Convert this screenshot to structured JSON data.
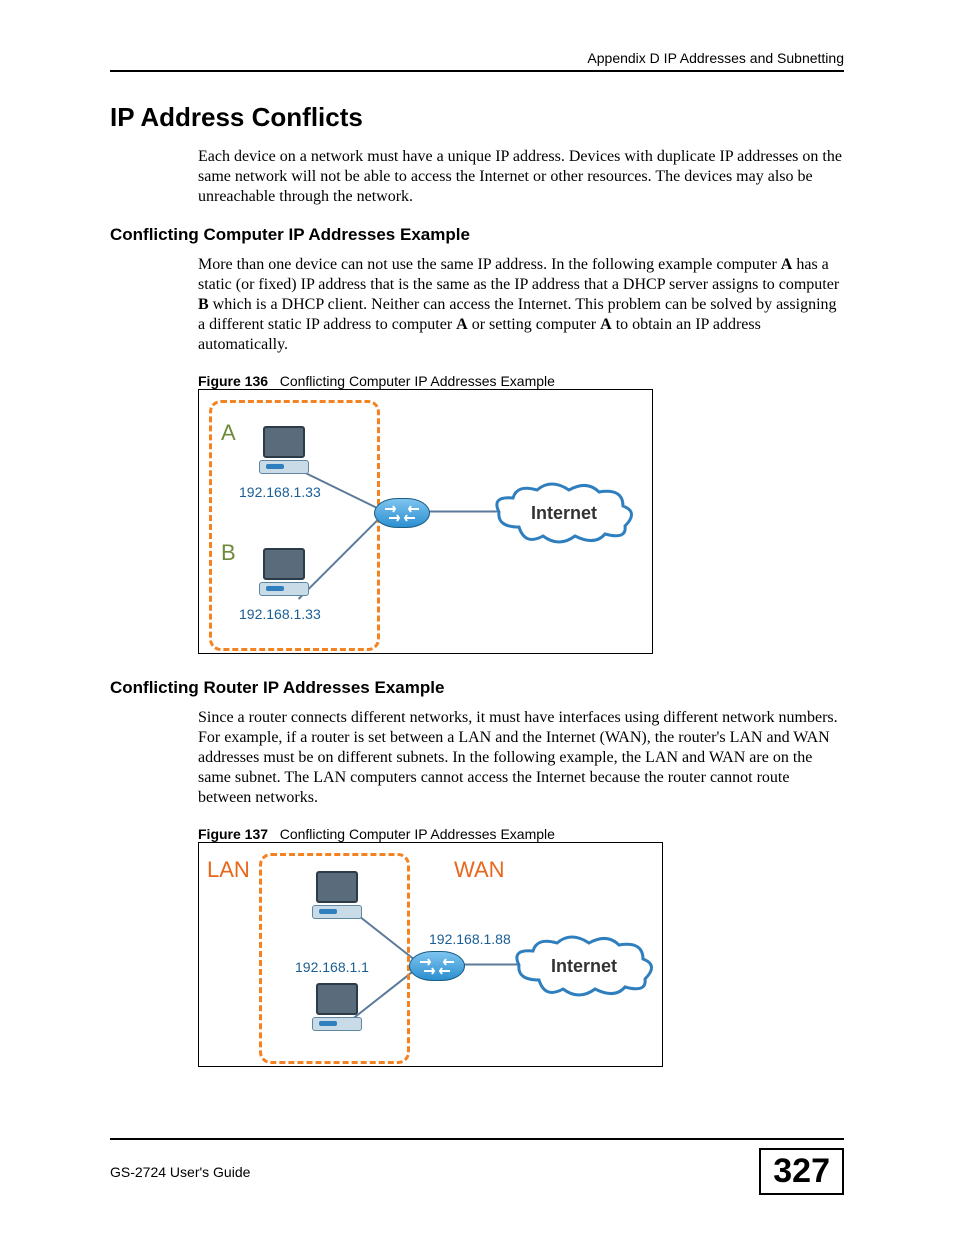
{
  "header": {
    "right": "Appendix D IP Addresses and Subnetting"
  },
  "h1": "IP Address Conflicts",
  "p1": "Each device on a network must have a unique IP address. Devices with duplicate IP addresses on the same network will not be able to access the Internet or other resources. The devices may also be unreachable through the network.",
  "h2a": "Conflicting Computer IP Addresses Example",
  "p2_parts": {
    "t1": "More than one device can not use the same IP address. In the following example computer ",
    "b1": "A",
    "t2": " has a static (or fixed) IP address that is the same as the IP address that a DHCP server assigns to computer ",
    "b2": "B",
    "t3": " which is a DHCP client. Neither can access the Internet. This problem can be solved by assigning a different static IP address to computer ",
    "b3": "A",
    "t4": " or setting computer ",
    "b4": "A",
    "t5": " to obtain an IP address automatically."
  },
  "fig1": {
    "num": "Figure 136",
    "title": "Conflicting Computer IP Addresses Example",
    "labelA": "A",
    "labelB": "B",
    "ipA": "192.168.1.33",
    "ipB": "192.168.1.33",
    "cloud": "Internet"
  },
  "h2b": "Conflicting Router IP Addresses Example",
  "p3": "Since a router connects different networks, it must have interfaces using different network numbers. For example, if a router is set between a LAN and the Internet (WAN), the router's LAN and WAN addresses must be on different subnets. In the following example, the LAN and WAN are on the same subnet. The LAN computers cannot access the Internet because the router cannot route between networks.",
  "fig2": {
    "num": "Figure 137",
    "title": "Conflicting Computer IP Addresses Example",
    "lan": "LAN",
    "wan": "WAN",
    "ipLan": "192.168.1.1",
    "ipWan": "192.168.1.88",
    "cloud": "Internet"
  },
  "footer": {
    "left": "GS-2724 User's Guide",
    "page": "327"
  }
}
